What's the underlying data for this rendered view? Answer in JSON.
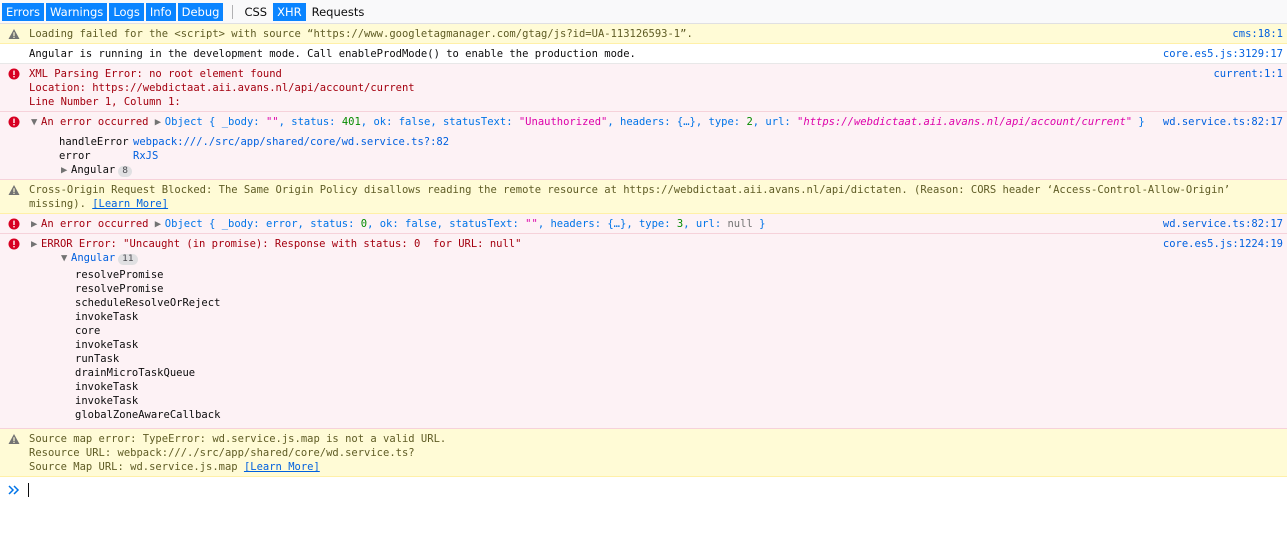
{
  "toolbar": {
    "filters": [
      {
        "label": "Errors",
        "active": true
      },
      {
        "label": "Warnings",
        "active": true
      },
      {
        "label": "Logs",
        "active": true
      },
      {
        "label": "Info",
        "active": true
      },
      {
        "label": "Debug",
        "active": true
      }
    ],
    "net_filters": [
      {
        "label": "CSS",
        "active": false
      },
      {
        "label": "XHR",
        "active": true
      },
      {
        "label": "Requests",
        "active": false
      }
    ]
  },
  "messages": {
    "m1": {
      "text": "Loading failed for the <script> with source “https://www.googletagmanager.com/gtag/js?id=UA-113126593-1”.",
      "loc": "cms:18:1"
    },
    "m2": {
      "text": "Angular is running in the development mode. Call enableProdMode() to enable the production mode.",
      "loc": "core.es5.js:3129:17"
    },
    "m3": {
      "line1": "XML Parsing Error: no root element found",
      "line2": "Location: https://webdictaat.aii.avans.nl/api/account/current",
      "line3": "Line Number 1, Column 1:",
      "loc": "current:1:1"
    },
    "m4": {
      "label": "An error occurred",
      "obj_prefix": "Object { _body: ",
      "body_val": "\"\"",
      "status_key": ", status: ",
      "status_val": "401",
      "ok_key": ", ok: ",
      "ok_val": "false",
      "st_key": ", statusText: ",
      "st_val": "\"Unauthorized\"",
      "rest": ", headers: {…}, type: ",
      "type_val": "2",
      "url_key": ", url: ",
      "url_val": "\"https://webdictaat.aii.avans.nl/api/account/current\"",
      "close": " }",
      "loc": "wd.service.ts:82:17",
      "frames": [
        {
          "fn": "handleError",
          "src": "webpack:///./src/app/shared/core/wd.service.ts?:82"
        },
        {
          "fn": "error",
          "src": "RxJS"
        }
      ],
      "group_label": "Angular",
      "group_count": "8"
    },
    "m5": {
      "text": "Cross-Origin Request Blocked: The Same Origin Policy disallows reading the remote resource at https://webdictaat.aii.avans.nl/api/dictaten. (Reason: CORS header ‘Access-Control-Allow-Origin’ missing). ",
      "link": "[Learn More]"
    },
    "m6": {
      "label": "An error occurred",
      "obj_prefix": "Object { _body: error, status: ",
      "status_val": "0",
      "ok_key": ", ok: ",
      "ok_val": "false",
      "st_key": ", statusText: ",
      "st_val": "\"\"",
      "rest": ", headers: {…}, type: ",
      "type_val": "3",
      "url_key": ", url: ",
      "url_val": "null",
      "close": " }",
      "loc": "wd.service.ts:82:17"
    },
    "m7": {
      "text": "ERROR Error: \"Uncaught (in promise): Response with status: 0  for URL: null\"",
      "loc": "core.es5.js:1224:19",
      "group_label": "Angular",
      "group_count": "11",
      "frames": [
        "resolvePromise",
        "resolvePromise",
        "scheduleResolveOrReject",
        "invokeTask",
        "core",
        "invokeTask",
        "runTask",
        "drainMicroTaskQueue",
        "invokeTask",
        "invokeTask",
        "globalZoneAwareCallback"
      ]
    },
    "m8": {
      "line1": "Source map error: TypeError: wd.service.js.map is not a valid URL.",
      "line2": "Resource URL: webpack:///./src/app/shared/core/wd.service.ts?",
      "line3_prefix": "Source Map URL: wd.service.js.map ",
      "link": "[Learn More]"
    }
  },
  "colors": {
    "accent": "#0a84ff",
    "warning_bg": "#fffbd6",
    "error_bg": "#fdf2f5",
    "error_text": "#a4000f",
    "link": "#0060df"
  },
  "icons": {
    "warning": "warning-triangle-icon",
    "error": "error-circle-icon",
    "prompt": "double-chevron-right-icon"
  }
}
